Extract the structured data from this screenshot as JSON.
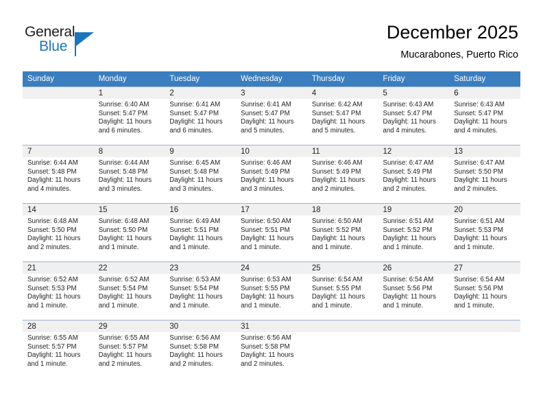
{
  "brand": {
    "name_part1": "General",
    "name_part2": "Blue",
    "logo_icon": "triangle-flag-icon",
    "accent_color": "#1b75bb"
  },
  "header": {
    "title": "December 2025",
    "subtitle": "Mucarabones, Puerto Rico"
  },
  "calendar": {
    "header_bg": "#3a7ebf",
    "daynum_bg": "#f0f0f0",
    "weekday_headers": [
      "Sunday",
      "Monday",
      "Tuesday",
      "Wednesday",
      "Thursday",
      "Friday",
      "Saturday"
    ],
    "weeks": [
      [
        {
          "day": "",
          "sunrise": "",
          "sunset": "",
          "daylight1": "",
          "daylight2": "",
          "empty": true
        },
        {
          "day": "1",
          "sunrise": "Sunrise: 6:40 AM",
          "sunset": "Sunset: 5:47 PM",
          "daylight1": "Daylight: 11 hours",
          "daylight2": "and 6 minutes."
        },
        {
          "day": "2",
          "sunrise": "Sunrise: 6:41 AM",
          "sunset": "Sunset: 5:47 PM",
          "daylight1": "Daylight: 11 hours",
          "daylight2": "and 6 minutes."
        },
        {
          "day": "3",
          "sunrise": "Sunrise: 6:41 AM",
          "sunset": "Sunset: 5:47 PM",
          "daylight1": "Daylight: 11 hours",
          "daylight2": "and 5 minutes."
        },
        {
          "day": "4",
          "sunrise": "Sunrise: 6:42 AM",
          "sunset": "Sunset: 5:47 PM",
          "daylight1": "Daylight: 11 hours",
          "daylight2": "and 5 minutes."
        },
        {
          "day": "5",
          "sunrise": "Sunrise: 6:43 AM",
          "sunset": "Sunset: 5:47 PM",
          "daylight1": "Daylight: 11 hours",
          "daylight2": "and 4 minutes."
        },
        {
          "day": "6",
          "sunrise": "Sunrise: 6:43 AM",
          "sunset": "Sunset: 5:47 PM",
          "daylight1": "Daylight: 11 hours",
          "daylight2": "and 4 minutes."
        }
      ],
      [
        {
          "day": "7",
          "sunrise": "Sunrise: 6:44 AM",
          "sunset": "Sunset: 5:48 PM",
          "daylight1": "Daylight: 11 hours",
          "daylight2": "and 4 minutes."
        },
        {
          "day": "8",
          "sunrise": "Sunrise: 6:44 AM",
          "sunset": "Sunset: 5:48 PM",
          "daylight1": "Daylight: 11 hours",
          "daylight2": "and 3 minutes."
        },
        {
          "day": "9",
          "sunrise": "Sunrise: 6:45 AM",
          "sunset": "Sunset: 5:48 PM",
          "daylight1": "Daylight: 11 hours",
          "daylight2": "and 3 minutes."
        },
        {
          "day": "10",
          "sunrise": "Sunrise: 6:46 AM",
          "sunset": "Sunset: 5:49 PM",
          "daylight1": "Daylight: 11 hours",
          "daylight2": "and 3 minutes."
        },
        {
          "day": "11",
          "sunrise": "Sunrise: 6:46 AM",
          "sunset": "Sunset: 5:49 PM",
          "daylight1": "Daylight: 11 hours",
          "daylight2": "and 2 minutes."
        },
        {
          "day": "12",
          "sunrise": "Sunrise: 6:47 AM",
          "sunset": "Sunset: 5:49 PM",
          "daylight1": "Daylight: 11 hours",
          "daylight2": "and 2 minutes."
        },
        {
          "day": "13",
          "sunrise": "Sunrise: 6:47 AM",
          "sunset": "Sunset: 5:50 PM",
          "daylight1": "Daylight: 11 hours",
          "daylight2": "and 2 minutes."
        }
      ],
      [
        {
          "day": "14",
          "sunrise": "Sunrise: 6:48 AM",
          "sunset": "Sunset: 5:50 PM",
          "daylight1": "Daylight: 11 hours",
          "daylight2": "and 2 minutes."
        },
        {
          "day": "15",
          "sunrise": "Sunrise: 6:48 AM",
          "sunset": "Sunset: 5:50 PM",
          "daylight1": "Daylight: 11 hours",
          "daylight2": "and 1 minute."
        },
        {
          "day": "16",
          "sunrise": "Sunrise: 6:49 AM",
          "sunset": "Sunset: 5:51 PM",
          "daylight1": "Daylight: 11 hours",
          "daylight2": "and 1 minute."
        },
        {
          "day": "17",
          "sunrise": "Sunrise: 6:50 AM",
          "sunset": "Sunset: 5:51 PM",
          "daylight1": "Daylight: 11 hours",
          "daylight2": "and 1 minute."
        },
        {
          "day": "18",
          "sunrise": "Sunrise: 6:50 AM",
          "sunset": "Sunset: 5:52 PM",
          "daylight1": "Daylight: 11 hours",
          "daylight2": "and 1 minute."
        },
        {
          "day": "19",
          "sunrise": "Sunrise: 6:51 AM",
          "sunset": "Sunset: 5:52 PM",
          "daylight1": "Daylight: 11 hours",
          "daylight2": "and 1 minute."
        },
        {
          "day": "20",
          "sunrise": "Sunrise: 6:51 AM",
          "sunset": "Sunset: 5:53 PM",
          "daylight1": "Daylight: 11 hours",
          "daylight2": "and 1 minute."
        }
      ],
      [
        {
          "day": "21",
          "sunrise": "Sunrise: 6:52 AM",
          "sunset": "Sunset: 5:53 PM",
          "daylight1": "Daylight: 11 hours",
          "daylight2": "and 1 minute."
        },
        {
          "day": "22",
          "sunrise": "Sunrise: 6:52 AM",
          "sunset": "Sunset: 5:54 PM",
          "daylight1": "Daylight: 11 hours",
          "daylight2": "and 1 minute."
        },
        {
          "day": "23",
          "sunrise": "Sunrise: 6:53 AM",
          "sunset": "Sunset: 5:54 PM",
          "daylight1": "Daylight: 11 hours",
          "daylight2": "and 1 minute."
        },
        {
          "day": "24",
          "sunrise": "Sunrise: 6:53 AM",
          "sunset": "Sunset: 5:55 PM",
          "daylight1": "Daylight: 11 hours",
          "daylight2": "and 1 minute."
        },
        {
          "day": "25",
          "sunrise": "Sunrise: 6:54 AM",
          "sunset": "Sunset: 5:55 PM",
          "daylight1": "Daylight: 11 hours",
          "daylight2": "and 1 minute."
        },
        {
          "day": "26",
          "sunrise": "Sunrise: 6:54 AM",
          "sunset": "Sunset: 5:56 PM",
          "daylight1": "Daylight: 11 hours",
          "daylight2": "and 1 minute."
        },
        {
          "day": "27",
          "sunrise": "Sunrise: 6:54 AM",
          "sunset": "Sunset: 5:56 PM",
          "daylight1": "Daylight: 11 hours",
          "daylight2": "and 1 minute."
        }
      ],
      [
        {
          "day": "28",
          "sunrise": "Sunrise: 6:55 AM",
          "sunset": "Sunset: 5:57 PM",
          "daylight1": "Daylight: 11 hours",
          "daylight2": "and 1 minute."
        },
        {
          "day": "29",
          "sunrise": "Sunrise: 6:55 AM",
          "sunset": "Sunset: 5:57 PM",
          "daylight1": "Daylight: 11 hours",
          "daylight2": "and 2 minutes."
        },
        {
          "day": "30",
          "sunrise": "Sunrise: 6:56 AM",
          "sunset": "Sunset: 5:58 PM",
          "daylight1": "Daylight: 11 hours",
          "daylight2": "and 2 minutes."
        },
        {
          "day": "31",
          "sunrise": "Sunrise: 6:56 AM",
          "sunset": "Sunset: 5:58 PM",
          "daylight1": "Daylight: 11 hours",
          "daylight2": "and 2 minutes."
        },
        {
          "day": "",
          "sunrise": "",
          "sunset": "",
          "daylight1": "",
          "daylight2": "",
          "empty": true
        },
        {
          "day": "",
          "sunrise": "",
          "sunset": "",
          "daylight1": "",
          "daylight2": "",
          "empty": true
        },
        {
          "day": "",
          "sunrise": "",
          "sunset": "",
          "daylight1": "",
          "daylight2": "",
          "empty": true
        }
      ]
    ]
  }
}
